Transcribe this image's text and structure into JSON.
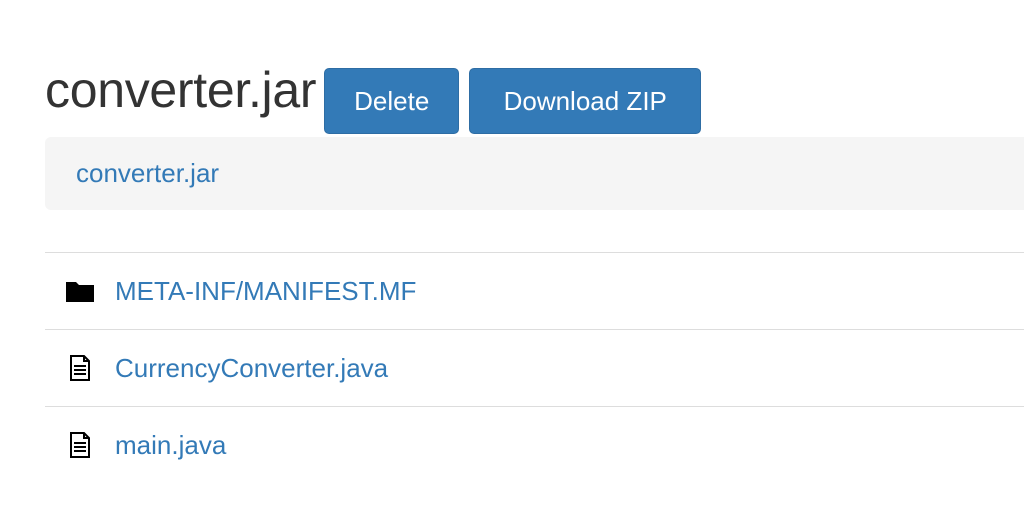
{
  "header": {
    "title": "converter.jar",
    "delete_label": "Delete",
    "download_label": "Download ZIP"
  },
  "breadcrumb": {
    "current": "converter.jar"
  },
  "files": [
    {
      "name": "META-INF/MANIFEST.MF",
      "icon": "folder-icon"
    },
    {
      "name": "CurrencyConverter.java",
      "icon": "file-icon"
    },
    {
      "name": "main.java",
      "icon": "file-icon"
    }
  ],
  "colors": {
    "accent": "#337ab7",
    "breadcrumb_bg": "#f5f5f5",
    "divider": "#dddddd"
  }
}
